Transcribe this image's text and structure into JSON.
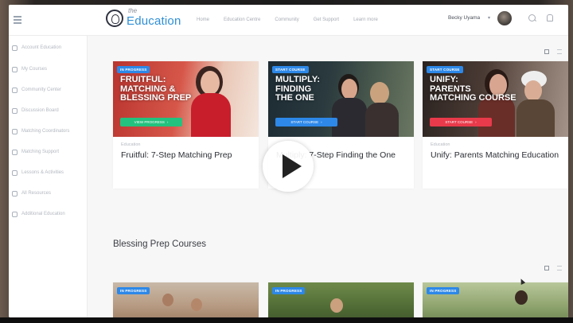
{
  "brand": {
    "small": "the",
    "name": "Education",
    "accent": "#2f8fd6"
  },
  "nav": {
    "links": [
      "Home",
      "Education Centre",
      "Community",
      "Get Support",
      "Learn more"
    ],
    "username": "Becky Uyama",
    "chevron": "▾"
  },
  "sidebar": {
    "items": [
      {
        "label": "Account Education",
        "icon": "compass-icon"
      },
      {
        "label": "My Courses",
        "icon": "book-icon"
      },
      {
        "label": "Community Center",
        "icon": "people-icon"
      },
      {
        "label": "Discussion Board",
        "icon": "chat-icon"
      },
      {
        "label": "Matching Coordinators",
        "icon": "heart-icon"
      },
      {
        "label": "Matching Support",
        "icon": "support-icon"
      },
      {
        "label": "Lessons & Activities",
        "icon": "calendar-icon"
      },
      {
        "label": "All Resources",
        "icon": "folder-icon"
      },
      {
        "label": "Additional Education",
        "icon": "graduation-icon"
      }
    ]
  },
  "courses": [
    {
      "badge": "IN PROGRESS",
      "thumb_title": "FRUITFUL:\nMATCHING &\nBLESSING PREP",
      "thumb_button": "VIEW PROGRESS",
      "button_color": "#23c27e",
      "category": "Education",
      "title": "Fruitful: 7-Step Matching Prep"
    },
    {
      "badge": "START COURSE",
      "thumb_title": "MULTIPLY:\nFINDING\nTHE ONE",
      "thumb_button": "START COURSE",
      "button_color": "#2d88e8",
      "category": "",
      "title": "Multiply: 7-Step Finding the One"
    },
    {
      "badge": "START COURSE",
      "thumb_title": "UNIFY:\nPARENTS\nMATCHING COURSE",
      "thumb_button": "START COURSE",
      "button_color": "#e83a4a",
      "category": "Education",
      "title": "Unify: Parents Matching Education"
    }
  ],
  "section": {
    "title": "Blessing Prep Courses"
  },
  "prep_courses": [
    {
      "badge": "IN PROGRESS"
    },
    {
      "badge": "IN PROGRESS"
    },
    {
      "badge": "IN PROGRESS"
    }
  ]
}
